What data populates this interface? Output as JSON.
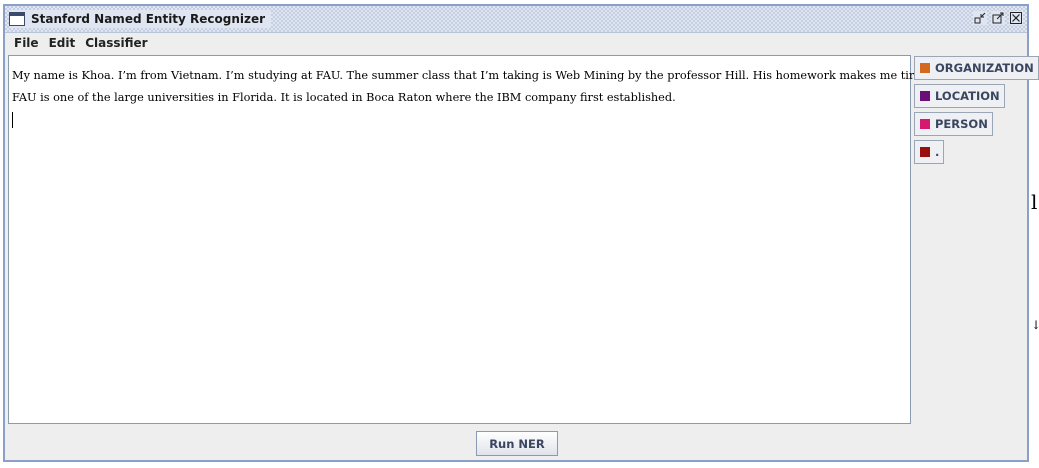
{
  "window": {
    "title": "Stanford Named Entity Recognizer"
  },
  "menu": {
    "items": [
      "File",
      "Edit",
      "Classifier"
    ]
  },
  "editor": {
    "lines": [
      "My name is Khoa. I’m from Vietnam. I’m studying at FAU. The summer class that I’m taking is Web Mining by the professor Hill. His homework makes me tired.",
      "FAU is one of the large universities in Florida. It is located in Boca Raton where the IBM company first established."
    ]
  },
  "legend": {
    "items": [
      {
        "label": "ORGANIZATION",
        "color": "#d2691e"
      },
      {
        "label": "LOCATION",
        "color": "#6a0f7a"
      },
      {
        "label": "PERSON",
        "color": "#d6186e"
      },
      {
        "label": ".",
        "color": "#9a0e0e"
      }
    ]
  },
  "actions": {
    "run_label": "Run NER"
  },
  "colors": {
    "window_border": "#8aa0c8",
    "background": "#eeeeee",
    "button_text": "#3a4660"
  }
}
